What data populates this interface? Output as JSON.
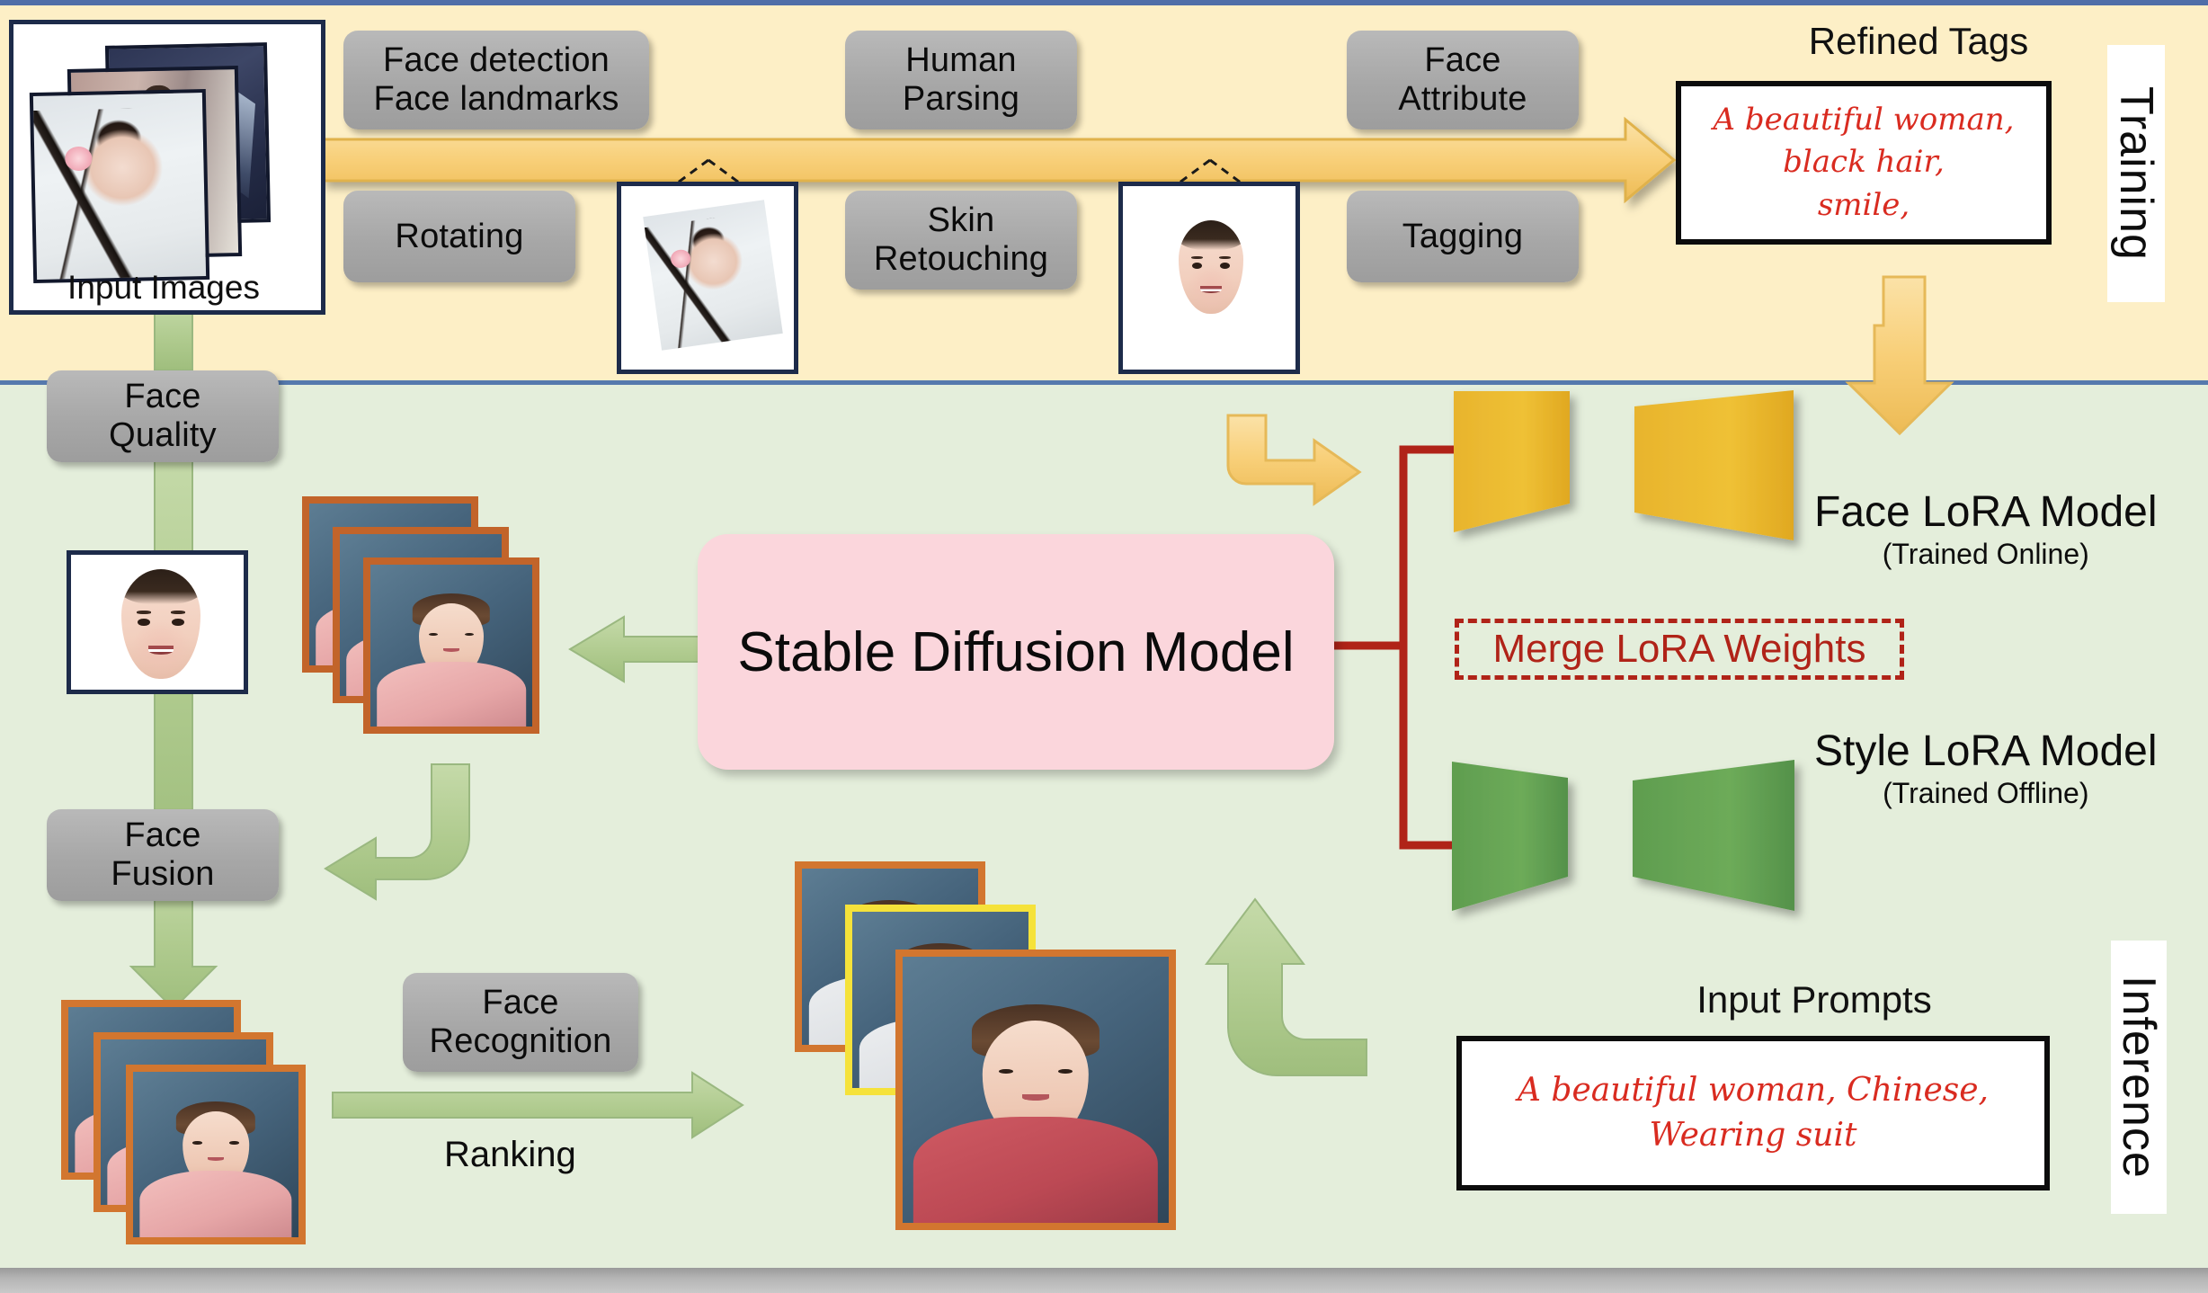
{
  "diagram": {
    "title_training": "Training",
    "title_inference": "Inference",
    "colors": {
      "training_band": "#fdefc6",
      "inference_band": "#e4eedb",
      "process_pill": "#a9a9a9",
      "face_lora": "#eab32f",
      "style_lora": "#5a9a4d",
      "merge_outline": "#b02318",
      "sd_box": "#fbd6dc",
      "tag_text": "#d92b20",
      "arrow_yellow": "#f5c96b",
      "arrow_green": "#a9c68c"
    }
  },
  "training": {
    "input_images_caption": "Input Images",
    "steps_top": [
      {
        "label": "Face detection\nFace landmarks"
      },
      {
        "label": "Human\nParsing"
      },
      {
        "label": "Face\nAttribute"
      }
    ],
    "steps_bottom": [
      {
        "label": "Rotating"
      },
      {
        "label": "Skin\nRetouching"
      },
      {
        "label": "Tagging"
      }
    ],
    "refined_tags": {
      "title": "Refined Tags",
      "text": "A beautiful woman,\nblack hair,\nsmile,"
    }
  },
  "inference": {
    "left_pipeline": [
      {
        "label": "Face\nQuality"
      },
      {
        "label": "Face\nFusion"
      }
    ],
    "face_recognition": {
      "label": "Face\nRecognition"
    },
    "ranking_label": "Ranking",
    "stable_diffusion": {
      "label": "Stable Diffusion Model"
    },
    "face_lora": {
      "title": "Face LoRA Model",
      "subtitle": "(Trained Online)"
    },
    "style_lora": {
      "title": "Style LoRA Model",
      "subtitle": "(Trained Offline)"
    },
    "merge": {
      "label": "Merge LoRA Weights"
    },
    "input_prompts": {
      "title": "Input Prompts",
      "text": "A beautiful woman, Chinese,\nWearing suit"
    }
  },
  "icons": {
    "stack_icon": "image-stack-icon",
    "face_crop_icon": "face-crop-icon",
    "trapezoid_icon": "lora-trapezoid-icon"
  }
}
